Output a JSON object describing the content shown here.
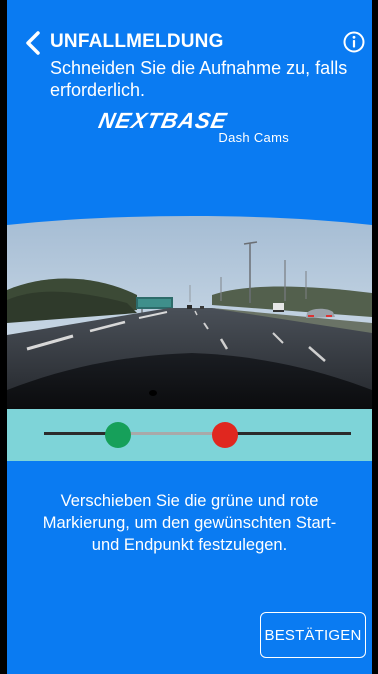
{
  "header": {
    "title": "UNFALLMELDUNG",
    "subtitle": "Schneiden Sie die Aufnahme zu, falls erforderlich.",
    "back_icon": "chevron-left-icon",
    "info_icon": "info-circle-icon"
  },
  "logo": {
    "brand": "NEXTBASE",
    "tagline": "Dash Cams"
  },
  "trim": {
    "start_fraction": 0.24,
    "end_fraction": 0.59,
    "start_color": "#16a05a",
    "end_color": "#e0271f"
  },
  "instruction": "Verschieben Sie die grüne und rote Markierung, um den gewünschten Start- und Endpunkt festzulegen.",
  "confirm_label": "BESTÄTIGEN",
  "colors": {
    "background": "#0a7bf2",
    "trim_bar": "#7ed4d8",
    "text": "#ffffff"
  }
}
